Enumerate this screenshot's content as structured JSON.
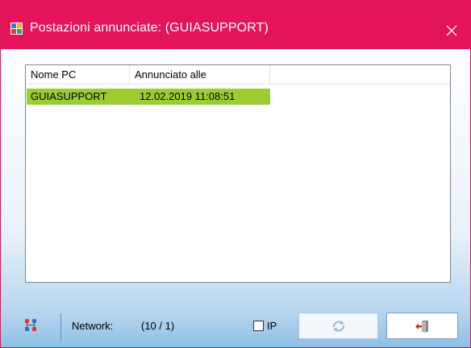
{
  "window": {
    "title": "Postazioni annunciate:  (GUIASUPPORT)",
    "accent_color": "#e3145a"
  },
  "list": {
    "columns": [
      "Nome PC",
      "Annunciato alle",
      ""
    ],
    "rows": [
      {
        "pc_name": "GUIASUPPORT",
        "announced_at": "12.02.2019 11:08:51",
        "highlight_color": "#9acd32"
      }
    ]
  },
  "status": {
    "network_label": "Network:",
    "network_count": "(10 / 1)",
    "ip_label": "IP",
    "ip_checked": false
  },
  "icons": {
    "app": "app-grid-icon",
    "close": "close-icon",
    "network": "network-settings-icon",
    "refresh": "refresh-icon",
    "exit": "exit-door-icon"
  }
}
